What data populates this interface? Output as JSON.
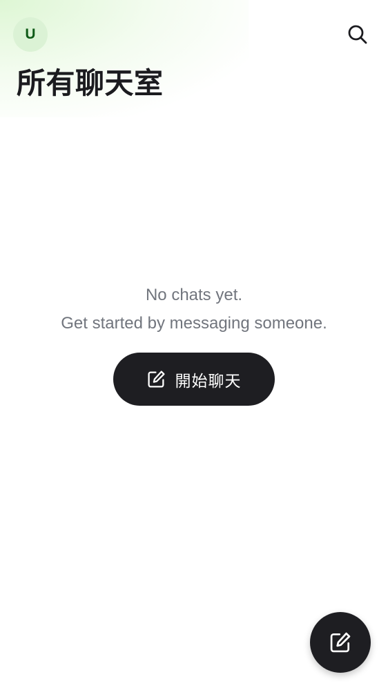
{
  "header": {
    "avatar_initial": "U",
    "search_icon": "search-icon",
    "title": "所有聊天室"
  },
  "empty_state": {
    "line1": "No chats yet.",
    "line2": "Get started by messaging someone.",
    "button_label": "開始聊天",
    "button_icon": "edit-icon"
  },
  "fab": {
    "icon": "edit-icon"
  },
  "colors": {
    "accent_dark": "#1e1e22",
    "avatar_bg": "#dbf2d5",
    "avatar_text": "#0f5a18",
    "muted_text": "#71757d"
  }
}
